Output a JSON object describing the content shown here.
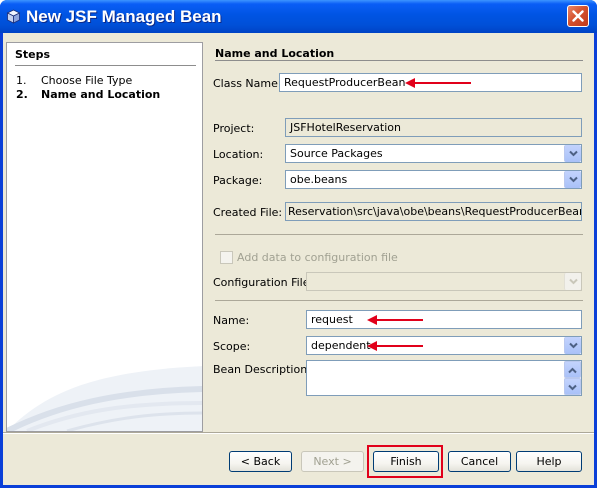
{
  "window": {
    "title": "New JSF Managed Bean",
    "title_icon": "netbeans-cube-icon",
    "close_icon": "close-icon"
  },
  "steps": {
    "heading": "Steps",
    "items": [
      {
        "number": "1.",
        "label": "Choose File Type",
        "current": false
      },
      {
        "number": "2.",
        "label": "Name and Location",
        "current": true
      }
    ]
  },
  "form": {
    "heading": "Name and Location",
    "class_name": {
      "label": "Class Name:",
      "value": "RequestProducerBean"
    },
    "project": {
      "label": "Project:",
      "value": "JSFHotelReservation"
    },
    "location": {
      "label": "Location:",
      "value": "Source Packages"
    },
    "package": {
      "label": "Package:",
      "value": "obe.beans"
    },
    "created_file": {
      "label": "Created File:",
      "value": "Reservation\\src\\java\\obe\\beans\\RequestProducerBean.java"
    },
    "add_config": {
      "label": "Add data to configuration file",
      "checked": false,
      "enabled": false
    },
    "config_file": {
      "label": "Configuration File:",
      "value": ""
    },
    "name": {
      "label": "Name:",
      "value": "request"
    },
    "scope": {
      "label": "Scope:",
      "value": "dependent"
    },
    "bean_description": {
      "label": "Bean Description:",
      "value": ""
    }
  },
  "buttons": {
    "back": "< Back",
    "next": "Next >",
    "finish": "Finish",
    "cancel": "Cancel",
    "help": "Help"
  },
  "annotation_color": "#e1001a",
  "accent_color": "#0054e3"
}
